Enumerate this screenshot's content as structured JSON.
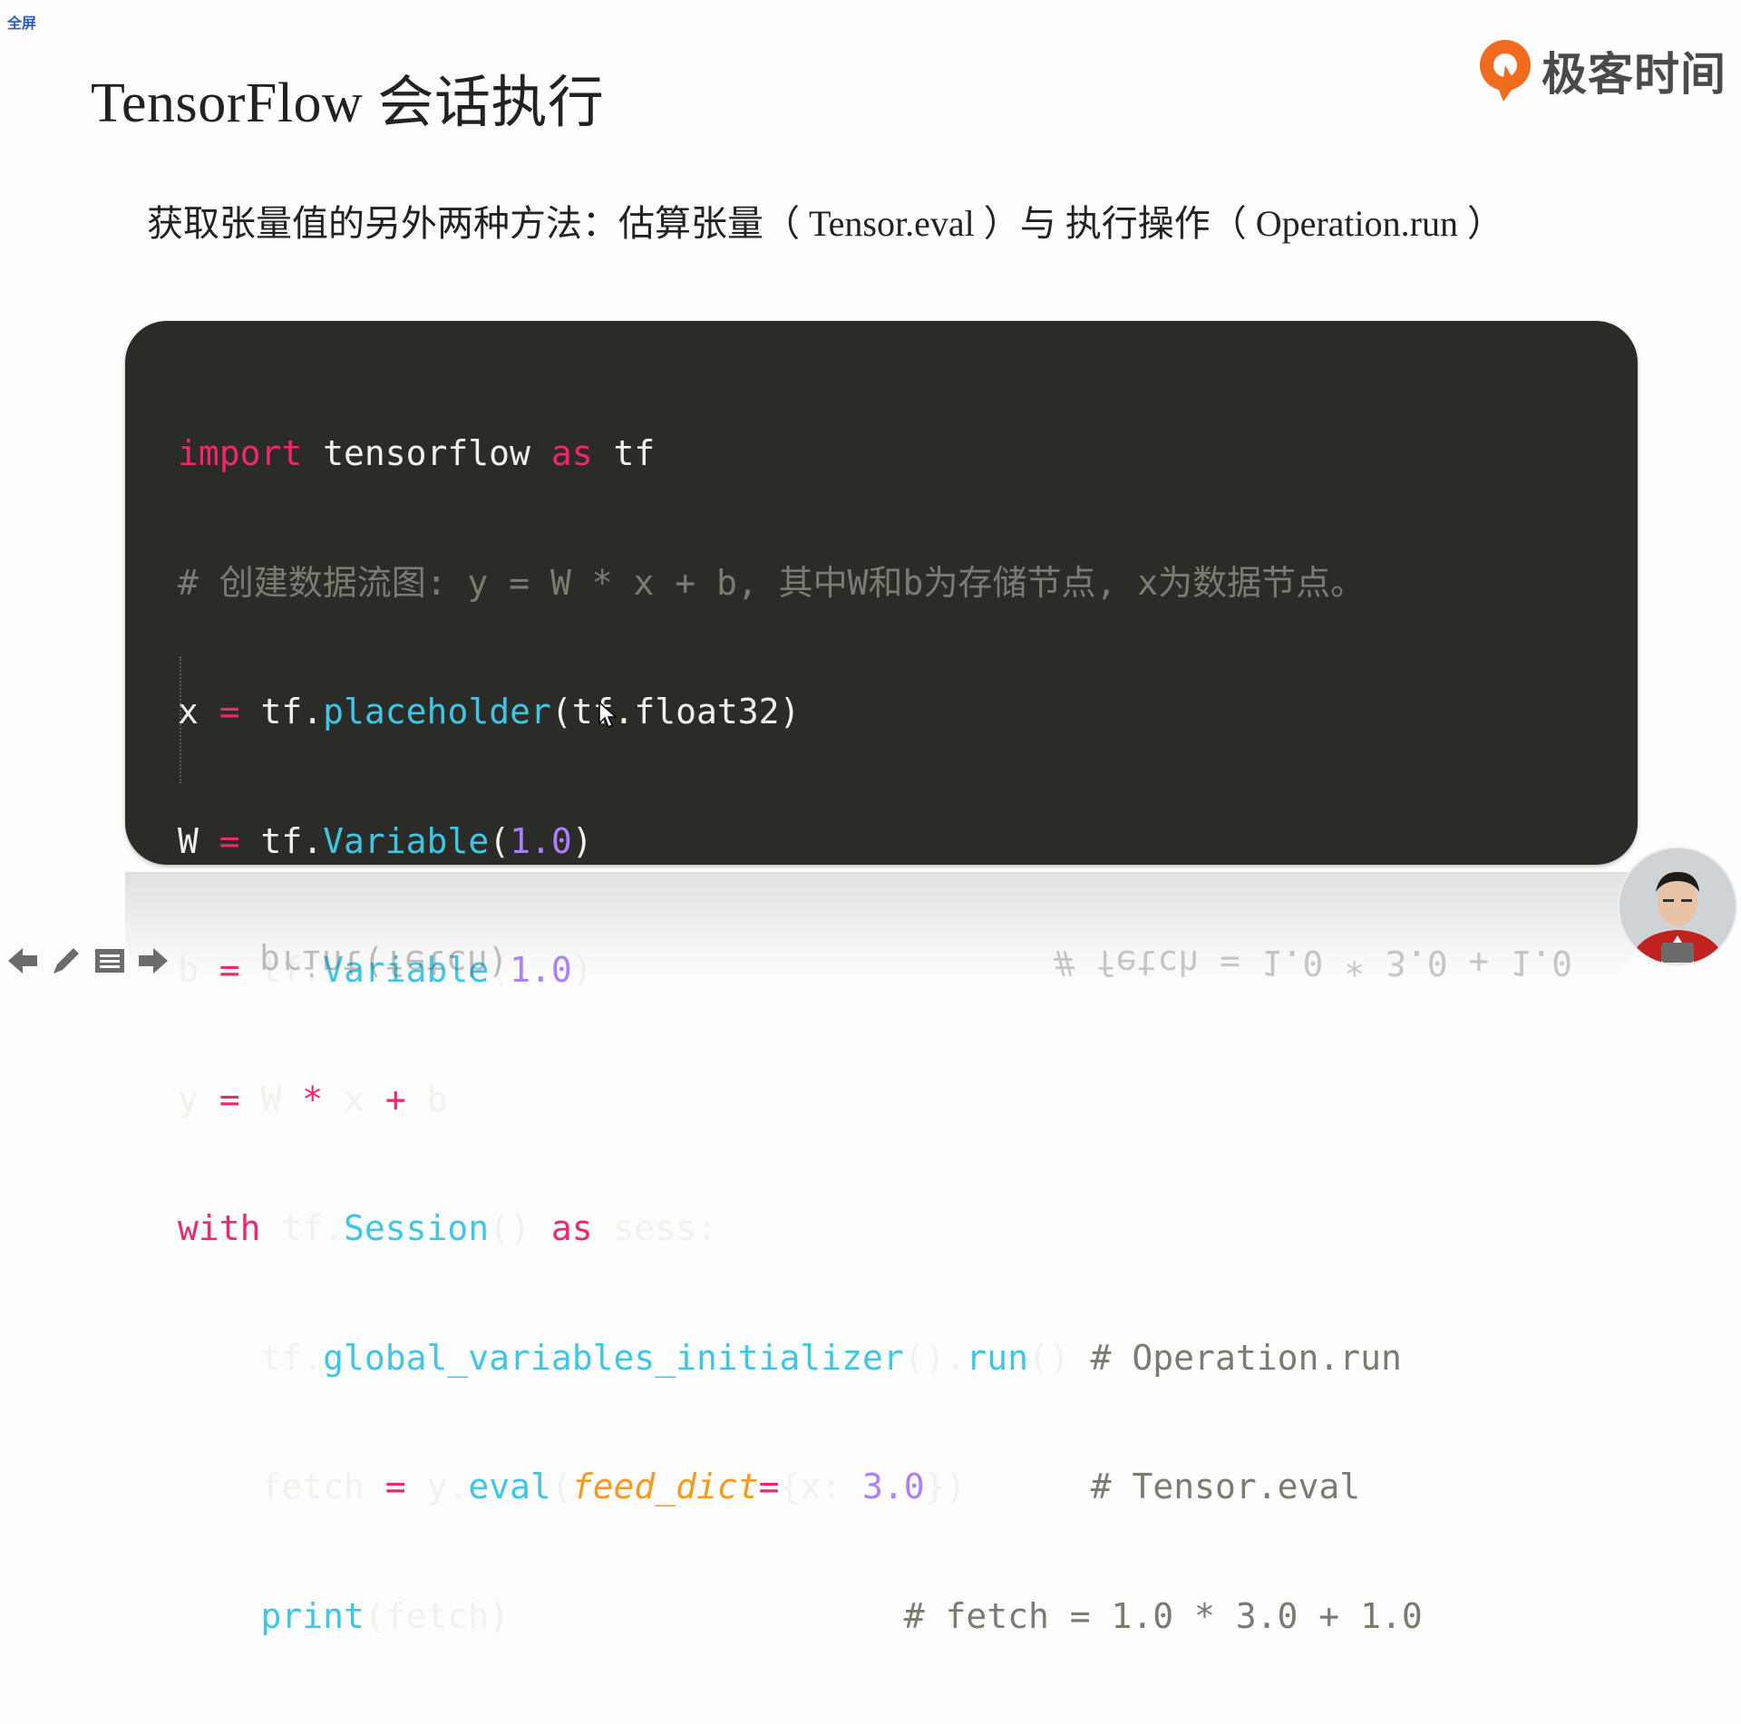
{
  "corner_label": "全屏",
  "slide": {
    "title": "TensorFlow 会话执行",
    "subtitle": "获取张量值的另外两种方法：估算张量（ Tensor.eval ）与 执行操作（ Operation.run ）"
  },
  "logo": {
    "text": "极客时间",
    "color": "#f06b1e"
  },
  "code": {
    "line1": {
      "kw_import": "import",
      "module": " tensorflow ",
      "kw_as": "as",
      "alias": " tf"
    },
    "line2": {
      "comment": "# 创建数据流图: y = W * x + b, 其中W和b为存储节点, x为数据节点。"
    },
    "line3": {
      "var": "x ",
      "op": "=",
      "obj": " tf.",
      "fn": "placeholder",
      "rest": "(tf.float32)"
    },
    "line4": {
      "var": "W ",
      "op": "=",
      "obj": " tf.",
      "fn": "Variable",
      "open": "(",
      "num": "1.0",
      "close": ")"
    },
    "line5": {
      "var": "b ",
      "op": "=",
      "obj": " tf.",
      "fn": "Variable",
      "open": "(",
      "num": "1.0",
      "close": ")"
    },
    "line6": {
      "var": "y ",
      "op1": "=",
      "w": " W ",
      "op2": "*",
      "x": " x ",
      "op3": "+",
      "b": " b"
    },
    "line7": {
      "kw_with": "with",
      "obj": " tf.",
      "fn": "Session",
      "paren": "() ",
      "kw_as": "as",
      "rest": " sess:"
    },
    "line8": {
      "indent": "    ",
      "obj": "tf.",
      "fn1": "global_variables_initializer",
      "mid": "().",
      "fn2": "run",
      "paren": "() ",
      "comment": "# Operation.run"
    },
    "line9": {
      "indent": "    ",
      "var": "fetch ",
      "op": "=",
      "obj": " y.",
      "fn": "eval",
      "open": "(",
      "arg": "feed_dict",
      "eq": "=",
      "dict": "{x: ",
      "num": "3.0",
      "close": "})",
      "pad": "      ",
      "comment": "# Tensor.eval"
    },
    "line10": {
      "indent": "    ",
      "fn": "print",
      "rest": "(fetch)",
      "pad": "                   ",
      "comment": "# fetch = 1.0 * 3.0 + 1.0"
    }
  },
  "reflection": {
    "left": "print(fetch)",
    "right": "# fetch = 1.0 * 3.0 + 1.0"
  },
  "icons": [
    "previous-arrow-icon",
    "pen-icon",
    "menu-icon",
    "next-arrow-icon",
    "presenter-avatar",
    "mouse-cursor-icon"
  ]
}
